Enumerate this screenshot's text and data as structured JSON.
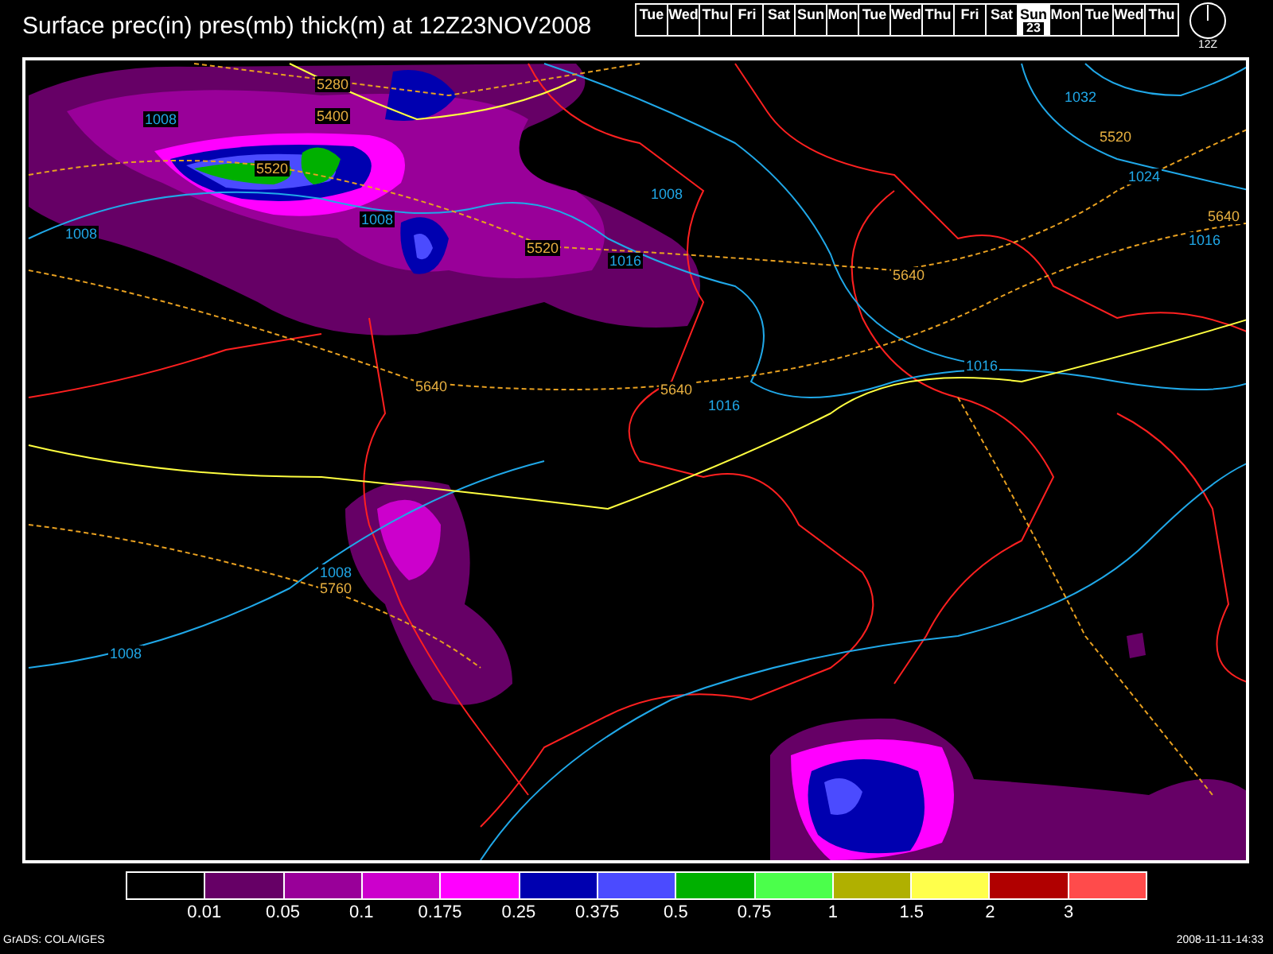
{
  "title": "Surface prec(in) pres(mb) thick(m) at 12Z23NOV2008",
  "days": [
    {
      "label": "Tue",
      "selected": false
    },
    {
      "label": "Wed",
      "selected": false
    },
    {
      "label": "Thu",
      "selected": false
    },
    {
      "label": "Fri",
      "selected": false
    },
    {
      "label": "Sat",
      "selected": false
    },
    {
      "label": "Sun",
      "selected": false
    },
    {
      "label": "Mon",
      "selected": false
    },
    {
      "label": "Tue",
      "selected": false
    },
    {
      "label": "Wed",
      "selected": false
    },
    {
      "label": "Thu",
      "selected": false
    },
    {
      "label": "Fri",
      "selected": false
    },
    {
      "label": "Sat",
      "selected": false
    },
    {
      "label": "Sun",
      "date": "23",
      "selected": true
    },
    {
      "label": "Mon",
      "selected": false
    },
    {
      "label": "Tue",
      "selected": false
    },
    {
      "label": "Wed",
      "selected": false
    },
    {
      "label": "Thu",
      "selected": false
    }
  ],
  "clock": {
    "label": "12Z"
  },
  "map": {
    "labels": [
      {
        "kind": "thickness",
        "text": "5280"
      },
      {
        "kind": "thickness",
        "text": "5400"
      },
      {
        "kind": "thickness",
        "text": "5520"
      },
      {
        "kind": "thickness",
        "text": "5520"
      },
      {
        "kind": "thickness",
        "text": "5640"
      },
      {
        "kind": "thickness",
        "text": "5640"
      },
      {
        "kind": "thickness",
        "text": "5760"
      },
      {
        "kind": "thickness",
        "text": "5640"
      },
      {
        "kind": "thickness",
        "text": "5520"
      },
      {
        "kind": "thickness",
        "text": "5640"
      },
      {
        "kind": "isobar",
        "text": "1008"
      },
      {
        "kind": "isobar",
        "text": "1008"
      },
      {
        "kind": "isobar",
        "text": "1008"
      },
      {
        "kind": "isobar",
        "text": "1016"
      },
      {
        "kind": "isobar",
        "text": "1008"
      },
      {
        "kind": "isobar",
        "text": "1016"
      },
      {
        "kind": "isobar",
        "text": "1016"
      },
      {
        "kind": "isobar",
        "text": "1032"
      },
      {
        "kind": "isobar",
        "text": "1024"
      },
      {
        "kind": "isobar",
        "text": "1016"
      },
      {
        "kind": "isobar",
        "text": "1008"
      },
      {
        "kind": "isobar",
        "text": "1008"
      }
    ]
  },
  "legend": {
    "swatches": [
      {
        "color": "#000000"
      },
      {
        "color": "#660066"
      },
      {
        "color": "#990099"
      },
      {
        "color": "#cc00cc"
      },
      {
        "color": "#ff00ff"
      },
      {
        "color": "#0000b0"
      },
      {
        "color": "#4b4bff"
      },
      {
        "color": "#00b000"
      },
      {
        "color": "#4bff4b"
      },
      {
        "color": "#b0b000"
      },
      {
        "color": "#ffff4b"
      },
      {
        "color": "#b00000"
      },
      {
        "color": "#ff4b4b"
      }
    ],
    "labels": [
      "0.01",
      "0.05",
      "0.1",
      "0.175",
      "0.25",
      "0.375",
      "0.5",
      "0.75",
      "1",
      "1.5",
      "2",
      "3"
    ]
  },
  "footer": {
    "credit": "GrADS: COLA/IGES",
    "timestamp": "2008-11-11-14:33"
  }
}
